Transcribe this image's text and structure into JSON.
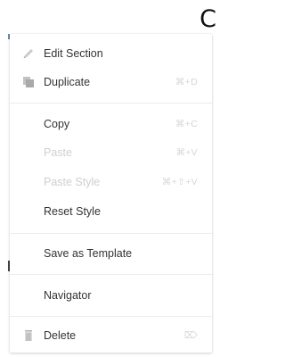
{
  "corner_letter": "C",
  "context_menu": {
    "edit_section": {
      "label": "Edit Section",
      "icon": "pencil-icon"
    },
    "duplicate": {
      "label": "Duplicate",
      "shortcut": "⌘+D",
      "icon": "duplicate-icon"
    },
    "copy": {
      "label": "Copy",
      "shortcut": "⌘+C"
    },
    "paste": {
      "label": "Paste",
      "shortcut": "⌘+V",
      "disabled": true
    },
    "paste_style": {
      "label": "Paste Style",
      "shortcut": "⌘+⇧+V",
      "disabled": true
    },
    "reset_style": {
      "label": "Reset Style"
    },
    "save_as_template": {
      "label": "Save as Template"
    },
    "navigator": {
      "label": "Navigator"
    },
    "delete": {
      "label": "Delete",
      "shortcut": "⌦",
      "icon": "trash-icon"
    }
  },
  "colors": {
    "text": "#333333",
    "disabled_text": "#cfcfcf",
    "shortcut_text": "#d6d6d6",
    "icon": "#c2c2c2",
    "divider": "#ececec"
  }
}
